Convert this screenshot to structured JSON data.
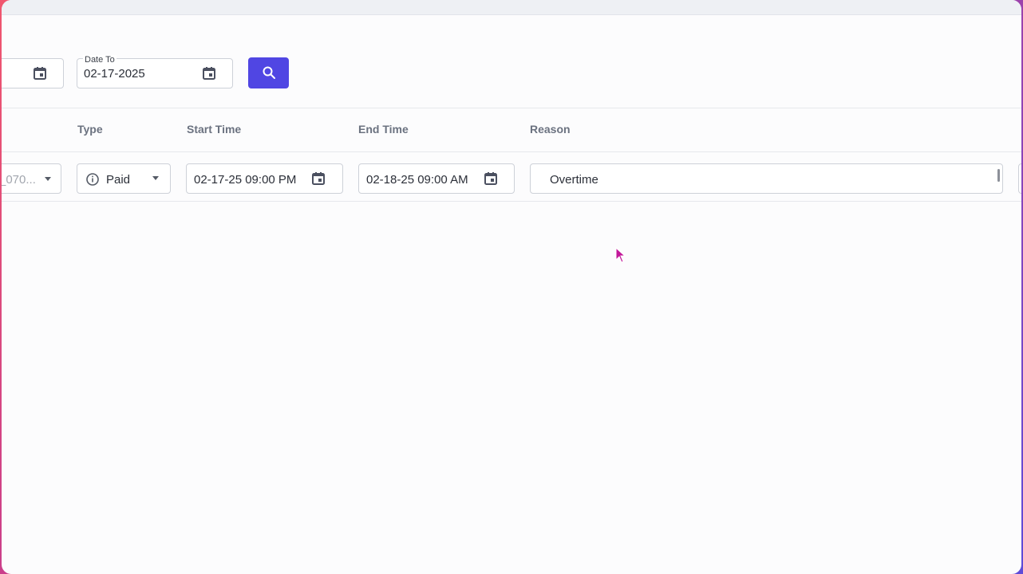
{
  "filters": {
    "date_to_label": "Date To",
    "date_to_value": "02-17-2025"
  },
  "table": {
    "columns": [
      "Type",
      "Start Time",
      "End Time",
      "Reason"
    ],
    "row": {
      "employee_partial": "_070...",
      "type": "Paid",
      "start_time": "02-17-25 09:00 PM",
      "end_time": "02-18-25 09:00 AM",
      "reason": "Overtime"
    }
  },
  "colors": {
    "accent": "#5046e3",
    "cursor": "#c2189a"
  }
}
